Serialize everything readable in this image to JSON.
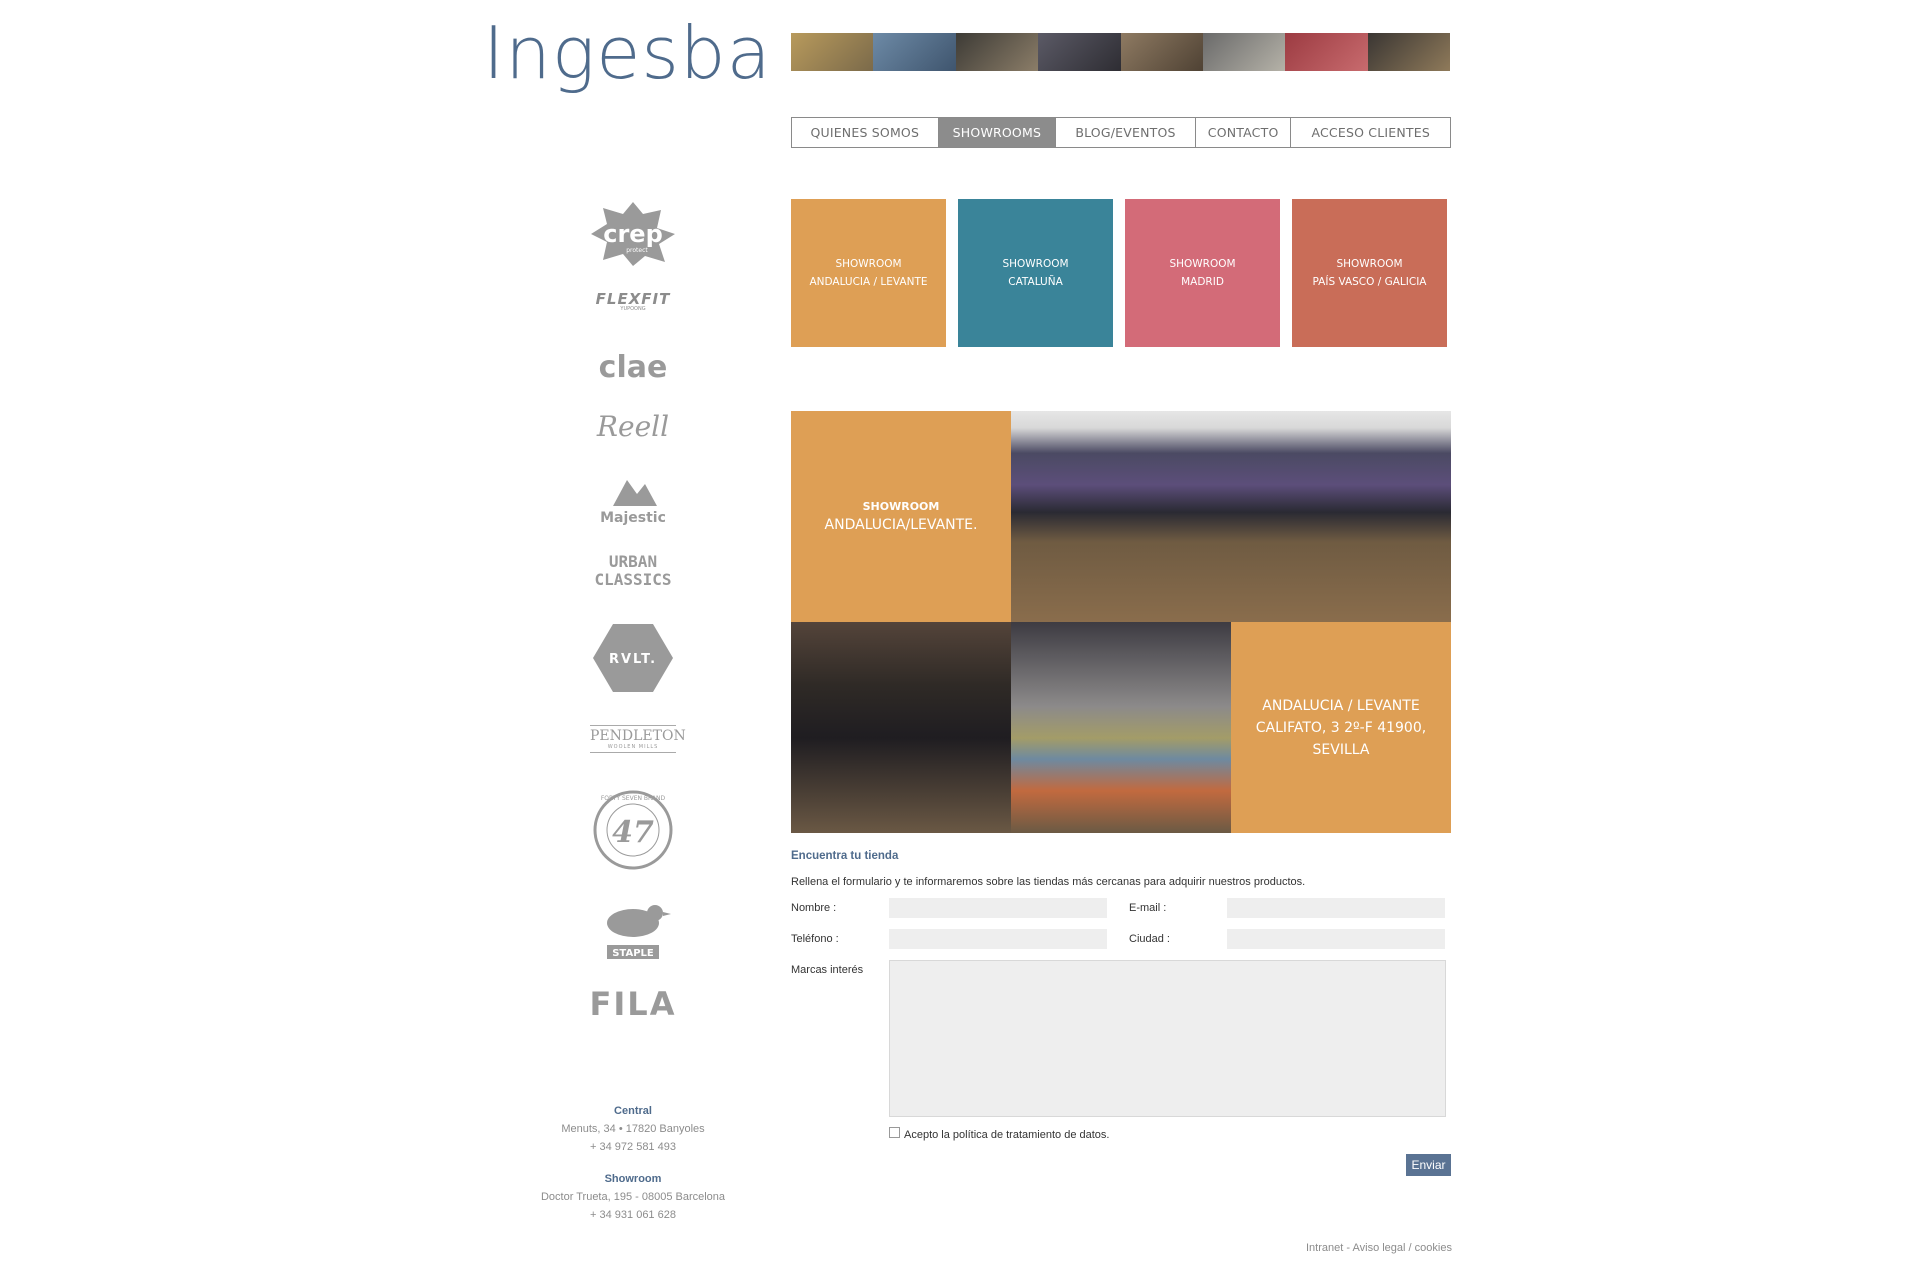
{
  "brand": {
    "logo_text": "Ingesba"
  },
  "nav": {
    "items": [
      {
        "label": "QUIENES SOMOS"
      },
      {
        "label": "SHOWROOMS"
      },
      {
        "label": "BLOG/EVENTOS"
      },
      {
        "label": "CONTACTO"
      },
      {
        "label": "ACCESO CLIENTES"
      }
    ],
    "active": "SHOWROOMS"
  },
  "tiles": [
    {
      "line1": "SHOWROOM",
      "line2": "ANDALUCIA / LEVANTE",
      "color": "#de9f55"
    },
    {
      "line1": "SHOWROOM",
      "line2": "CATALUÑA",
      "color": "#3a8499"
    },
    {
      "line1": "SHOWROOM",
      "line2": "MADRID",
      "color": "#d36b78"
    },
    {
      "line1": "SHOWROOM",
      "line2": "PAÍS VASCO / GALICIA",
      "color": "#c96d58"
    }
  ],
  "brands": {
    "crep": "crep",
    "crep_sub": "protect",
    "flexfit": "FLEXFIT",
    "flexfit_sub": "YUPOONG",
    "clae": "clae",
    "reell": "Reell",
    "majestic": "Majestic",
    "urban": "URBAN",
    "classics": "CLASSICS",
    "rvlt": "RVLT.",
    "pendleton": "PENDLETON",
    "pendleton_sub": "WOOLEN MILLS",
    "brand47": "47",
    "brand47_ring": "FORTY SEVEN BRAND",
    "staple": "STAPLE",
    "fila": "FILA"
  },
  "showroom": {
    "label_small": "SHOWROOM",
    "label_big": "ANDALUCIA/LEVANTE.",
    "address_line1": "ANDALUCIA / LEVANTE",
    "address_line2": "CALIFATO, 3 2º-F 41900,",
    "address_line3": "SEVILLA"
  },
  "form": {
    "title": "Encuentra tu tienda",
    "intro": "Rellena el formulario y te informaremos sobre las tiendas más cercanas para adquirir nuestros productos.",
    "nombre_label": "Nombre :",
    "email_label": "E-mail :",
    "telefono_label": "Teléfono :",
    "ciudad_label": "Ciudad :",
    "marcas_label": "Marcas interés",
    "privacy_label": "Acepto la política de tratamiento de datos.",
    "submit_label": "Enviar"
  },
  "contact": {
    "central_title": "Central",
    "central_address": "Menuts, 34 • 17820 Banyoles",
    "central_phone": "+ 34 972 581 493",
    "showroom_title": "Showroom",
    "showroom_address": "Doctor Trueta, 195 - 08005 Barcelona",
    "showroom_phone": "+ 34 931 061 628"
  },
  "footer": {
    "intranet": "Intranet",
    "sep1": " - ",
    "aviso": "Aviso legal",
    "sep2": " / ",
    "cookies": "cookies"
  },
  "colors": {
    "accent_blue": "#4f6b8c",
    "orange": "#de9f55",
    "teal": "#3a8499",
    "pink": "#d36b78",
    "terracotta": "#c96d58"
  }
}
